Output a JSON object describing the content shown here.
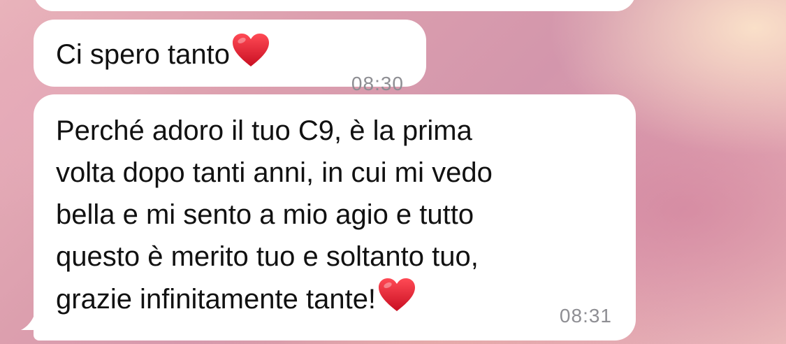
{
  "conversation": {
    "messages": [
      {
        "text": "Ci spero tanto",
        "emoji": "heart",
        "time": "08:30"
      },
      {
        "text": "Perché adoro il tuo C9, è la prima\nvolta dopo tanti anni, in cui mi vedo\nbella e mi sento a mio agio e tutto\nquesto è merito tuo e soltanto tuo,\ngrazie infinitamente tante!",
        "emoji": "heart",
        "time": "08:31"
      }
    ]
  },
  "colors": {
    "bubble": "#ffffff",
    "text": "#111111",
    "timestamp": "#8e8e93",
    "heart": "#e0162b"
  }
}
